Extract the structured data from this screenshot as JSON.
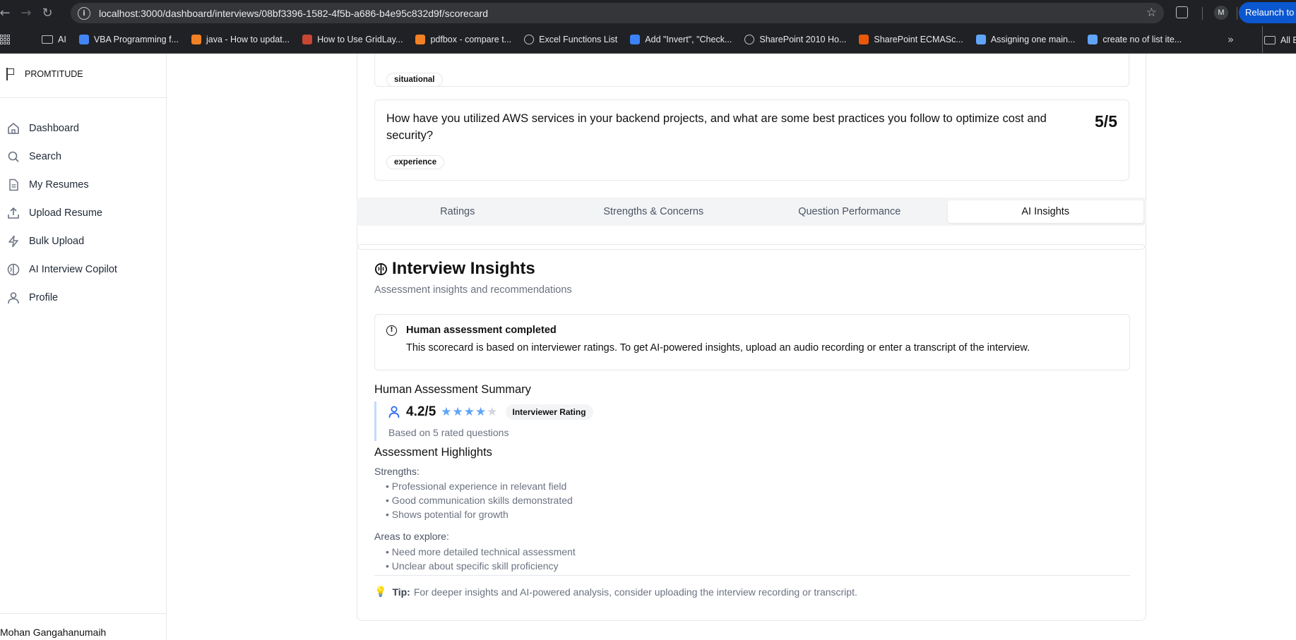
{
  "browser": {
    "url": "localhost:3000/dashboard/interviews/08bf3396-1582-4f5b-a686-b4e95c832d9f/scorecard",
    "profile_initial": "M",
    "relaunch_label": "Relaunch to u",
    "bookmarks": [
      {
        "label": "AI",
        "icon": "folder-icon"
      },
      {
        "label": "VBA Programming f...",
        "icon": "google-icon",
        "color": "#4285f4"
      },
      {
        "label": "java - How to updat...",
        "icon": "stackoverflow-icon",
        "color": "#f48024"
      },
      {
        "label": "How to Use GridLay...",
        "icon": "oracle-icon",
        "color": "#c74634"
      },
      {
        "label": "pdfbox - compare t...",
        "icon": "stackoverflow-icon",
        "color": "#f48024"
      },
      {
        "label": "Excel Functions List",
        "icon": "globe-icon",
        "color": "#bdc1c6"
      },
      {
        "label": "Add \"Invert\", \"Check...",
        "icon": "doc-icon",
        "color": "#3b82f6"
      },
      {
        "label": "SharePoint 2010 Ho...",
        "icon": "globe-icon",
        "color": "#bdc1c6"
      },
      {
        "label": "SharePoint ECMASc...",
        "icon": "site-icon",
        "color": "#ea580c"
      },
      {
        "label": "Assigning one main...",
        "icon": "wing-icon",
        "color": "#60a5fa"
      },
      {
        "label": "create no of list ite...",
        "icon": "wing-icon",
        "color": "#60a5fa"
      }
    ],
    "all_bookmarks_label": "All B"
  },
  "sidebar": {
    "brand": "PROMTITUDE",
    "items": [
      {
        "label": "Dashboard",
        "icon": "home-icon"
      },
      {
        "label": "Search",
        "icon": "search-icon"
      },
      {
        "label": "My Resumes",
        "icon": "document-icon"
      },
      {
        "label": "Upload Resume",
        "icon": "upload-icon"
      },
      {
        "label": "Bulk Upload",
        "icon": "lightning-icon"
      },
      {
        "label": "AI Interview Copilot",
        "icon": "brain-icon"
      },
      {
        "label": "Profile",
        "icon": "user-icon"
      }
    ],
    "user_name": "Mohan Gangahanumaih"
  },
  "questions": [
    {
      "tag": "situational"
    },
    {
      "text": "How have you utilized AWS services in your backend projects, and what are some best practices you follow to optimize cost and security?",
      "score": "5/5",
      "tag": "experience"
    }
  ],
  "tabs": [
    {
      "label": "Ratings"
    },
    {
      "label": "Strengths & Concerns"
    },
    {
      "label": "Question Performance"
    },
    {
      "label": "AI Insights",
      "active": true
    }
  ],
  "insights": {
    "title": "Interview Insights",
    "subtitle": "Assessment insights and recommendations",
    "alert_title": "Human assessment completed",
    "alert_text": "This scorecard is based on interviewer ratings. To get AI-powered insights, upload an audio recording or enter a transcript of the interview.",
    "summary_heading": "Human Assessment Summary",
    "rating_value": "4.2/5",
    "rating_stars": 4.2,
    "rating_badge": "Interviewer Rating",
    "rating_note": "Based on 5 rated questions",
    "highlights_heading": "Assessment Highlights",
    "strengths_label": "Strengths:",
    "strengths": [
      "Professional experience in relevant field",
      "Good communication skills demonstrated",
      "Shows potential for growth"
    ],
    "explore_label": "Areas to explore:",
    "explore": [
      "Need more detailed technical assessment",
      "Unclear about specific skill proficiency"
    ],
    "tip_label": "Tip:",
    "tip_text": "For deeper insights and AI-powered analysis, consider uploading the interview recording or transcript."
  }
}
